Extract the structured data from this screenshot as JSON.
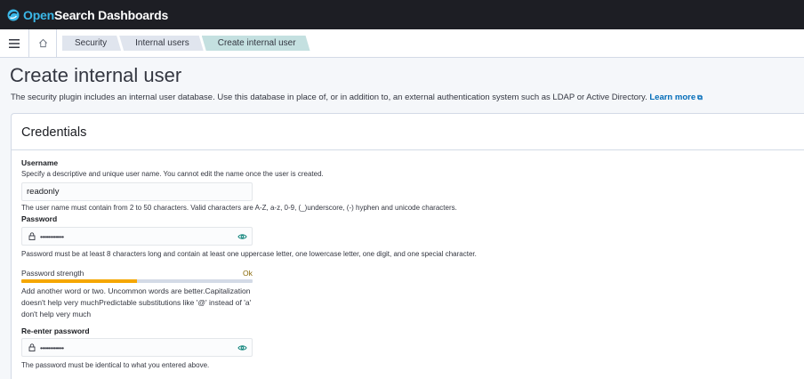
{
  "app": {
    "brand_open": "Open",
    "brand_rest": "Search Dashboards"
  },
  "breadcrumbs": [
    "Security",
    "Internal users",
    "Create internal user"
  ],
  "page": {
    "title": "Create internal user",
    "description": "The security plugin includes an internal user database. Use this database in place of, or in addition to, an external authentication system such as LDAP or Active Directory.",
    "learn_more": "Learn more"
  },
  "credentials": {
    "title": "Credentials",
    "username": {
      "label": "Username",
      "description": "Specify a descriptive and unique user name. You cannot edit the name once the user is created.",
      "value": "readonly",
      "help": "The user name must contain from 2 to 50 characters. Valid characters are A-Z, a-z, 0-9, (_)underscore, (-) hyphen and unicode characters."
    },
    "password": {
      "label": "Password",
      "masked": "••••••••••••",
      "help": "Password must be at least 8 characters long and contain at least one uppercase letter, one lowercase letter, one digit, and one special character."
    },
    "strength": {
      "label": "Password strength",
      "value": "Ok",
      "level": 0.5,
      "color": "#f5a700",
      "feedback": "Add another word or two. Uncommon words are better.Capitalization doesn't help very muchPredictable substitutions like '@' instead of 'a' don't help very much"
    },
    "reenter": {
      "label": "Re-enter password",
      "masked": "••••••••••••",
      "help": "The password must be identical to what you entered above."
    }
  },
  "colors": {
    "header_bg": "#1d1e24",
    "link": "#006bb8",
    "active_crumb": "#c4e0e0"
  }
}
